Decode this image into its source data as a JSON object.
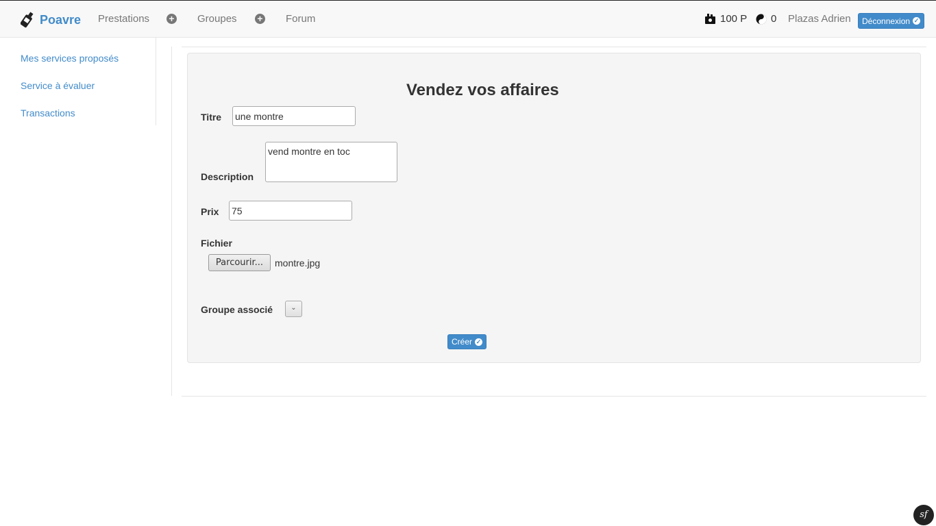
{
  "navbar": {
    "brand": "Poavre",
    "links": {
      "prestations": "Prestations",
      "groupes": "Groupes",
      "forum": "Forum"
    },
    "balance": "100 P",
    "karma": "0",
    "user_name": "Plazas Adrien",
    "logout_label": "Déconnexion"
  },
  "sidebar": {
    "items": [
      {
        "label": "Mes services proposés"
      },
      {
        "label": "Service à évaluer"
      },
      {
        "label": "Transactions"
      }
    ]
  },
  "form": {
    "title": "Vendez vos affaires",
    "titre_label": "Titre",
    "titre_value": "une montre",
    "description_label": "Description",
    "description_value": "vend montre en toc",
    "prix_label": "Prix",
    "prix_value": "75",
    "fichier_label": "Fichier",
    "browse_label": "Parcourir...",
    "file_name": "montre.jpg",
    "groupe_label": "Groupe associé",
    "groupe_value": "",
    "submit_label": "Créer"
  },
  "colors": {
    "accent": "#428bca",
    "well_bg": "#f5f5f5"
  },
  "icons": {
    "brand": "bottle-icon",
    "money": "money-bag-icon",
    "karma": "yin-yang-icon",
    "footer": "symfony-icon"
  }
}
